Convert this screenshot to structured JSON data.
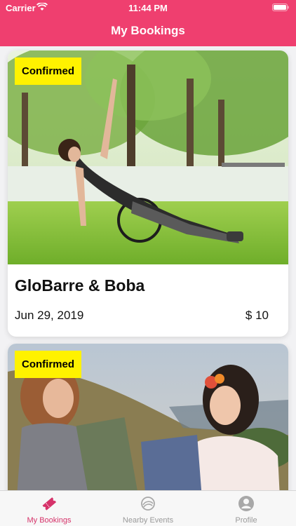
{
  "status_bar": {
    "carrier": "Carrier",
    "time": "11:44 PM"
  },
  "header": {
    "title": "My Bookings"
  },
  "bookings": [
    {
      "status": "Confirmed",
      "title": "GloBarre & Boba",
      "date": "Jun 29, 2019",
      "price": "$ 10"
    },
    {
      "status": "Confirmed"
    }
  ],
  "tabs": [
    {
      "label": "My Bookings",
      "icon": "ticket-icon",
      "active": true
    },
    {
      "label": "Nearby Events",
      "icon": "swirl-icon",
      "active": false
    },
    {
      "label": "Profile",
      "icon": "profile-icon",
      "active": false
    }
  ],
  "colors": {
    "accent": "#ef3f6f",
    "badge": "#fff200",
    "active_tab": "#d6336a"
  }
}
